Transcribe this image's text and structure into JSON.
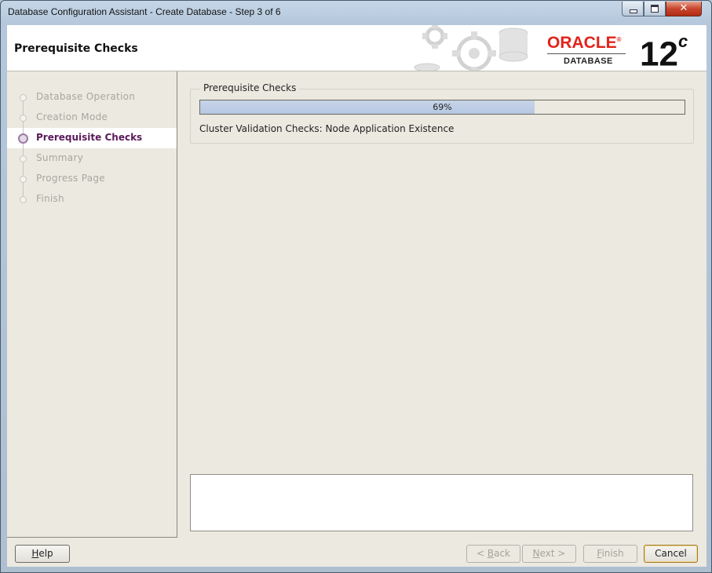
{
  "window": {
    "title": "Database Configuration Assistant - Create Database - Step 3 of 6",
    "controls": [
      "minimize-icon",
      "maximize-icon",
      "close-icon"
    ],
    "close_glyph": "✕"
  },
  "header": {
    "title": "Prerequisite Checks",
    "logo_word": "ORACLE",
    "logo_trademark": "®",
    "logo_subtitle": "DATABASE",
    "version_number": "12",
    "version_suffix": "c",
    "brand_color": "#e2231a"
  },
  "sidebar": {
    "items": [
      {
        "label": "Database Operation",
        "active": false
      },
      {
        "label": "Creation Mode",
        "active": false
      },
      {
        "label": "Prerequisite Checks",
        "active": true
      },
      {
        "label": "Summary",
        "active": false
      },
      {
        "label": "Progress Page",
        "active": false
      },
      {
        "label": "Finish",
        "active": false
      }
    ]
  },
  "main": {
    "group_title": "Prerequisite Checks",
    "progress_percent": 69,
    "progress_text": "69%",
    "status_text": "Cluster Validation Checks: Node Application Existence",
    "details_text": ""
  },
  "footer": {
    "help": {
      "mnemonic": "H",
      "rest": "elp"
    },
    "back": {
      "prefix": "< ",
      "mnemonic": "B",
      "rest": "ack",
      "enabled": false
    },
    "next": {
      "mnemonic": "N",
      "rest": "ext >",
      "enabled": false
    },
    "finish": {
      "mnemonic": "F",
      "rest": "inish",
      "enabled": false
    },
    "cancel": {
      "label": "Cancel",
      "enabled": true
    }
  }
}
